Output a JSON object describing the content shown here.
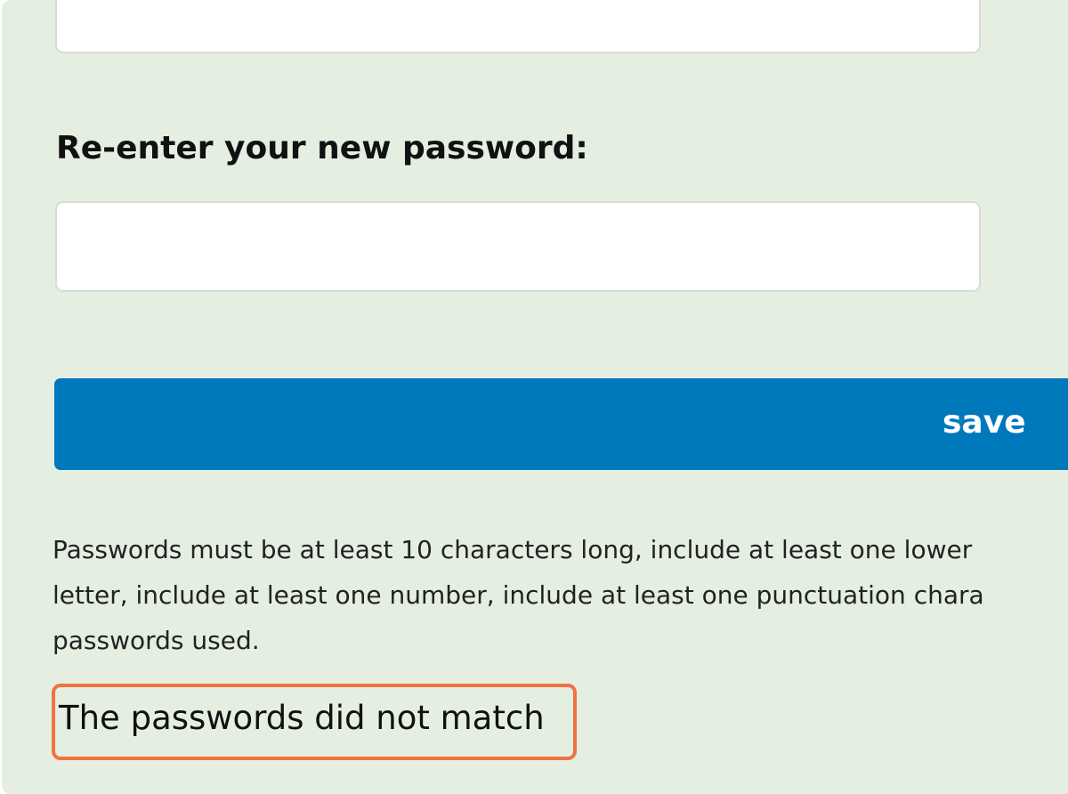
{
  "form": {
    "new_password_value": "",
    "reenter_label": "Re-enter your new password:",
    "reenter_value": "",
    "save_label": "save",
    "hint_lines": [
      "Passwords must be at least 10 characters long, include at least one lower",
      "letter, include at least one number, include at least one punctuation chara",
      "passwords used."
    ],
    "error_message": "The passwords did not match"
  },
  "colors": {
    "panel_background": "#e4efe2",
    "button_background": "#0078bc",
    "highlight_border": "#f07242"
  }
}
